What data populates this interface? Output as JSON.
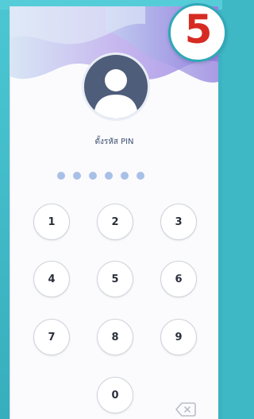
{
  "step_badge": "5",
  "pin_screen": {
    "title": "ตั้งรหัส PIN",
    "dot_count": 6,
    "avatar_icon": "user-silhouette-icon",
    "backspace_icon": "backspace-icon"
  },
  "keypad": {
    "keys": [
      "1",
      "2",
      "3",
      "4",
      "5",
      "6",
      "7",
      "8",
      "9",
      "0"
    ]
  },
  "colors": {
    "frame": "#3fb8c6",
    "wave_light": "#c9b8ef",
    "wave_mid": "#9c8be3",
    "avatar_bg": "#4e5d79",
    "pin_dot": "#a9c0e6",
    "badge_number": "#d62b22"
  }
}
